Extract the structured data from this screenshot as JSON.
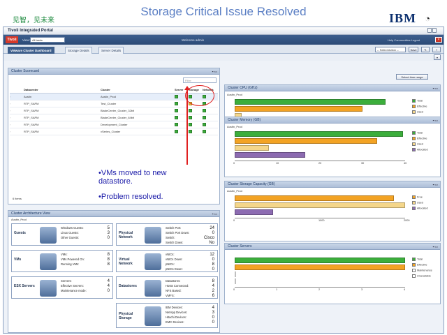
{
  "slide": {
    "logo_text": "见智，见未来",
    "title": "Storage Critical Issue Resolved",
    "ibm": "IBM",
    "annotation": [
      "•VMs moved to new datastore.",
      "•Problem resolved."
    ]
  },
  "window": {
    "title": "Tivoli Integrated Portal"
  },
  "nav": {
    "brand": "Tivoli",
    "view_label": "View:",
    "view_value": "All tasks",
    "center": "Welcome  admin",
    "links": "Help   Communities   Logout"
  },
  "tabs": [
    {
      "label": "VMware Cluster Dashboard"
    },
    {
      "label": "Storage Details"
    },
    {
      "label": "Server Details"
    }
  ],
  "actions": {
    "select_action": "-- Select Action --",
    "save": "Save"
  },
  "select_time_range": "Select time range",
  "scorecard": {
    "title": "Cluster Scorecard",
    "filter_placeholder": "Filter",
    "columns": [
      "Datacenter",
      "Cluster",
      "Server",
      "Storage",
      "Network"
    ],
    "rows": [
      {
        "dc": "Austin",
        "cluster": "Austin_Prod",
        "server": "ok",
        "storage": "ok",
        "network": "ok"
      },
      {
        "dc": "RTP_SAPM",
        "cluster": "Test_Cluster",
        "server": "ok",
        "storage": "warn",
        "network": "ok"
      },
      {
        "dc": "RTP_SAPM",
        "cluster": "BladeCenter_Cluster_32bit",
        "server": "ok",
        "storage": "ok",
        "network": "ok"
      },
      {
        "dc": "RTP_SAPM",
        "cluster": "BladeCenter_Cluster_64bit",
        "server": "ok",
        "storage": "ok",
        "network": "ok"
      },
      {
        "dc": "RTP_SAPM",
        "cluster": "Development_Cluster",
        "server": "ok",
        "storage": "ok",
        "network": "ok"
      },
      {
        "dc": "RTP_SAPM",
        "cluster": "vSeries_Cluster",
        "server": "ok",
        "storage": "ok",
        "network": "ok"
      }
    ],
    "footer": "6 items"
  },
  "arch": {
    "title": "Cluster Architecture View",
    "cluster": "Austin_Prod",
    "boxes": [
      {
        "label": "Guests",
        "items": [
          [
            "Windows Guests:",
            "5"
          ],
          [
            "Linux Guests:",
            "3"
          ],
          [
            "Other Guests:",
            "0"
          ]
        ]
      },
      {
        "label": "Physical Network",
        "items": [
          [
            "Switch Port:",
            "24"
          ],
          [
            "Switch Port Down:",
            "0"
          ],
          [
            "Switch:",
            "Cisco"
          ],
          [
            "Switch Down:",
            "No"
          ]
        ]
      },
      {
        "label": "VMs",
        "items": [
          [
            "VMs:",
            "8"
          ],
          [
            "VMs Powered On:",
            "8"
          ],
          [
            "Running VMs:",
            "8"
          ]
        ]
      },
      {
        "label": "Virtual Network",
        "items": [
          [
            "vNICs:",
            "12"
          ],
          [
            "vNICs Down:",
            "0"
          ],
          [
            "pNICs:",
            "8"
          ],
          [
            "pNICs Down:",
            "0"
          ]
        ]
      },
      {
        "label": "ESX Servers",
        "items": [
          [
            "Servers:",
            "4"
          ],
          [
            "Effective Servers:",
            "4"
          ],
          [
            "Maintenance mode:",
            "0"
          ]
        ]
      },
      {
        "label": "Datastores",
        "items": [
          [
            "Datastores:",
            "8"
          ],
          [
            "Hosts Connected:",
            "4"
          ],
          [
            "NFS Based:",
            "2"
          ],
          [
            "VMFS:",
            "6"
          ]
        ]
      },
      {
        "label": "Physical Storage",
        "items": [
          [
            "IBM Devices:",
            "4"
          ],
          [
            "NetApp Devices:",
            "3"
          ],
          [
            "Hitachi Devices:",
            "0"
          ],
          [
            "EMC Devices:",
            "0"
          ]
        ]
      }
    ]
  },
  "charts": {
    "cpu": {
      "title": "Cluster CPU (GHz)",
      "cluster": "Austin_Prod",
      "ticks": [
        "0",
        "10"
      ],
      "chart_data": {
        "type": "bar",
        "series": [
          {
            "name": "Total",
            "values": [
              17.7
            ]
          },
          {
            "name": "Effective",
            "values": [
              15.0
            ]
          },
          {
            "name": "Used",
            "values": [
              0.8
            ]
          }
        ],
        "xlim": [
          0,
          20
        ]
      },
      "legend": [
        {
          "name": "Total",
          "color": "#3cae3c"
        },
        {
          "name": "Effective",
          "color": "#f3a324"
        },
        {
          "name": "Used",
          "color": "#f4d68a"
        }
      ]
    },
    "memory": {
      "title": "Cluster Memory (GB)",
      "cluster": "Austin_Prod",
      "ticks": [
        "0",
        "10",
        "20",
        "30",
        "40"
      ],
      "chart_data": {
        "type": "bar",
        "series": [
          {
            "name": "Total",
            "values": [
              39.5
            ]
          },
          {
            "name": "Effective",
            "values": [
              33.5
            ]
          },
          {
            "name": "Used",
            "values": [
              8.0
            ]
          },
          {
            "name": "Allocated",
            "values": [
              16.5
            ]
          }
        ],
        "xlim": [
          0,
          40
        ]
      },
      "legend": [
        {
          "name": "Total",
          "color": "#3cae3c"
        },
        {
          "name": "Effective",
          "color": "#f3a324"
        },
        {
          "name": "Used",
          "color": "#f4d68a"
        },
        {
          "name": "Allocated",
          "color": "#8c6bb1"
        }
      ]
    },
    "storage": {
      "title": "Cluster Storage Capacity (GB)",
      "cluster": "Austin_Prod",
      "ticks": [
        "0",
        "1000",
        "2000"
      ],
      "chart_data": {
        "type": "bar",
        "series": [
          {
            "name": "Free",
            "values": [
              1870
            ]
          },
          {
            "name": "Used",
            "values": [
              2030
            ]
          },
          {
            "name": "Allocated",
            "values": [
              450
            ]
          }
        ],
        "xlim": [
          0,
          2000
        ]
      },
      "legend": [
        {
          "name": "Free",
          "color": "#f3a324"
        },
        {
          "name": "Used",
          "color": "#f4d68a"
        },
        {
          "name": "Allocated",
          "color": "#8c6bb1"
        }
      ]
    },
    "servers": {
      "title": "Cluster Servers",
      "ticks": [
        "0",
        "1",
        "2",
        "3",
        "4"
      ],
      "chart_data": {
        "type": "bar",
        "series": [
          {
            "name": "Total",
            "values": [
              4
            ]
          },
          {
            "name": "Effective",
            "values": [
              4
            ]
          },
          {
            "name": "Maintenance",
            "values": [
              0
            ]
          },
          {
            "name": "Unavailable",
            "values": [
              0
            ]
          }
        ],
        "xlim": [
          0,
          4
        ]
      },
      "legend": [
        {
          "name": "Total",
          "color": "#3cae3c"
        },
        {
          "name": "Effective",
          "color": "#f3a324"
        },
        {
          "name": "Maintenance",
          "color": "#ffffff"
        },
        {
          "name": "Unavailable",
          "color": "#ffffff"
        }
      ]
    }
  }
}
